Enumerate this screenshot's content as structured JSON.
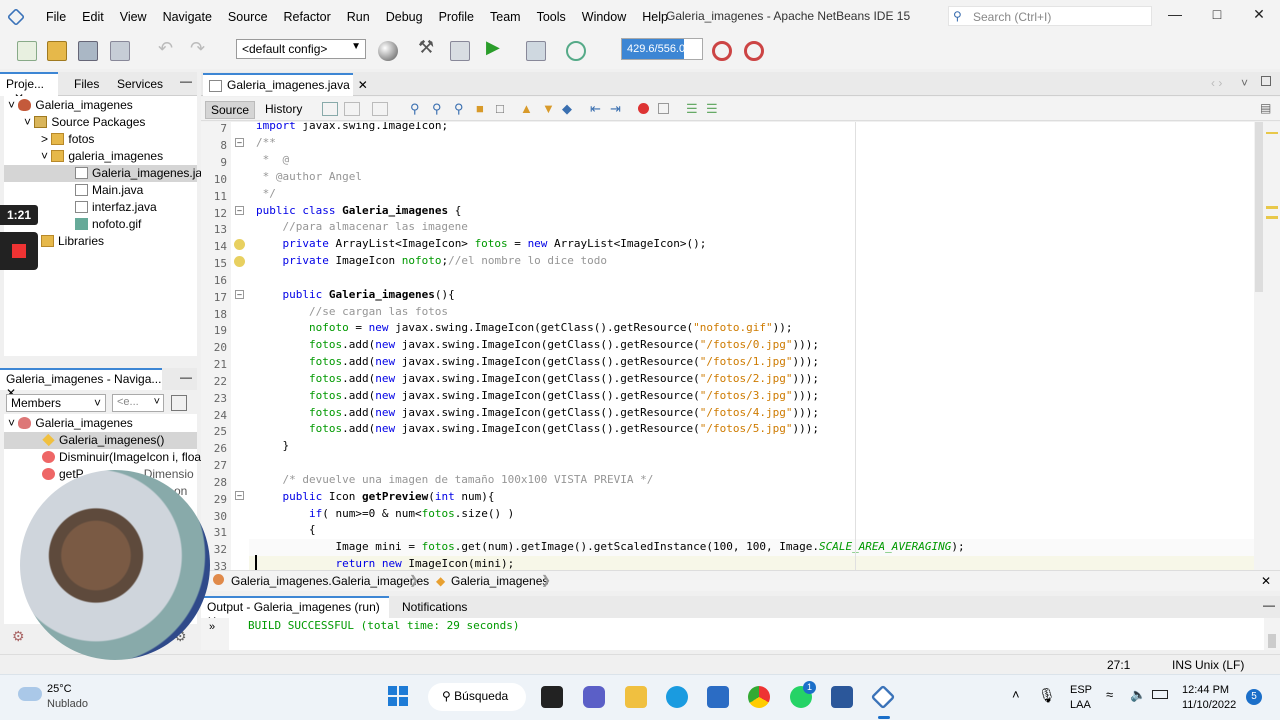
{
  "menubar": {
    "items": [
      "File",
      "Edit",
      "View",
      "Navigate",
      "Source",
      "Refactor",
      "Run",
      "Debug",
      "Profile",
      "Team",
      "Tools",
      "Window",
      "Help"
    ],
    "window_title": "Galeria_imagenes - Apache NetBeans IDE 15",
    "search_placeholder": "Search (Ctrl+I)"
  },
  "toolbar": {
    "config": "<default config>",
    "memory": "429.6/556.0MB",
    "memory_fraction": 0.77
  },
  "project_panel": {
    "tabs": [
      "Proje...",
      "Files",
      "Services"
    ],
    "tree": [
      {
        "label": "Galeria_imagenes",
        "icon": "project-icon"
      },
      {
        "label": "Source Packages",
        "icon": "source-packages-icon"
      },
      {
        "label": "fotos",
        "icon": "package-icon"
      },
      {
        "label": "galeria_imagenes",
        "icon": "package-icon"
      },
      {
        "label": "Galeria_imagenes.jav",
        "icon": "java-file-icon"
      },
      {
        "label": "Main.java",
        "icon": "java-file-icon"
      },
      {
        "label": "interfaz.java",
        "icon": "java-file-icon"
      },
      {
        "label": "nofoto.gif",
        "icon": "image-file-icon"
      },
      {
        "label": "Libraries",
        "icon": "libraries-icon"
      }
    ]
  },
  "navigator": {
    "title": "Galeria_imagenes - Naviga...",
    "filter": "Members",
    "filter2": "<e...",
    "tree": [
      "Galeria_imagenes",
      "Galeria_imagenes()",
      "Disminuir(ImageIcon i, floa",
      "getP",
      "Dimensio",
      "on"
    ]
  },
  "editor": {
    "tab": "Galeria_imagenes.java",
    "source_tab": "Source",
    "history_tab": "History",
    "line_numbers": [
      "7",
      "8",
      "9",
      "10",
      "11",
      "12",
      "13",
      "14",
      "15",
      "16",
      "17",
      "18",
      "19",
      "20",
      "21",
      "22",
      "23",
      "24",
      "25",
      "26",
      "27",
      "28",
      "29",
      "30",
      "31",
      "32",
      "33"
    ],
    "breadcrumb1": "Galeria_imagenes.Galeria_imagenes",
    "breadcrumb2": "Galeria_imagenes"
  },
  "output": {
    "tab": "Output - Galeria_imagenes (run)",
    "notifications": "Notifications",
    "text": "BUILD SUCCESSFUL (total time: 29 seconds)"
  },
  "status": {
    "position": "27:1",
    "mode": "INS",
    "line_ending": "Unix (LF)"
  },
  "recording": {
    "timer": "1:21"
  },
  "taskbar": {
    "weather_temp": "25°C",
    "weather_desc": "Nublado",
    "search": "Búsqueda",
    "lang1": "ESP",
    "lang2": "LAA",
    "time": "12:44 PM",
    "date": "11/10/2022",
    "notif_count": "5",
    "whatsapp_badge": "1"
  }
}
